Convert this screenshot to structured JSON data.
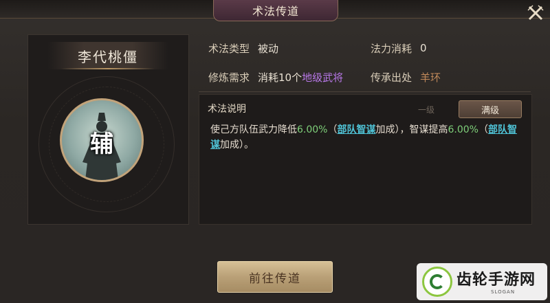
{
  "window": {
    "title": "术法传道"
  },
  "character": {
    "name": "李代桃僵",
    "portrait_char": "辅"
  },
  "info": {
    "type_label": "术法类型",
    "type_value": "被动",
    "cost_label": "法力消耗",
    "cost_value": "0",
    "req_label": "修炼需求",
    "req_prefix": "消耗10个",
    "req_highlight": "地级武将",
    "source_label": "传承出处",
    "source_value": "羊环"
  },
  "description": {
    "title": "术法说明",
    "level_basic": "一级",
    "level_max": "满级",
    "part1": "使己方队伍武力降低",
    "pct1": "6.00%",
    "paren_open1": "（",
    "link1": "部队智谋",
    "paren_close1": "加成），智谋提高",
    "pct2": "6.00%",
    "paren_open2": "（",
    "link2": "部队智谋",
    "paren_close2": "加成）。"
  },
  "actions": {
    "go_button": "前往传道"
  },
  "watermark": {
    "text": "齿轮手游网",
    "slogan": "SLOGAN"
  },
  "colors": {
    "accent_purple": "#b878e8",
    "accent_green": "#7fd07a",
    "link_cyan": "#4fc3d6",
    "source_brown": "#c0895a"
  }
}
